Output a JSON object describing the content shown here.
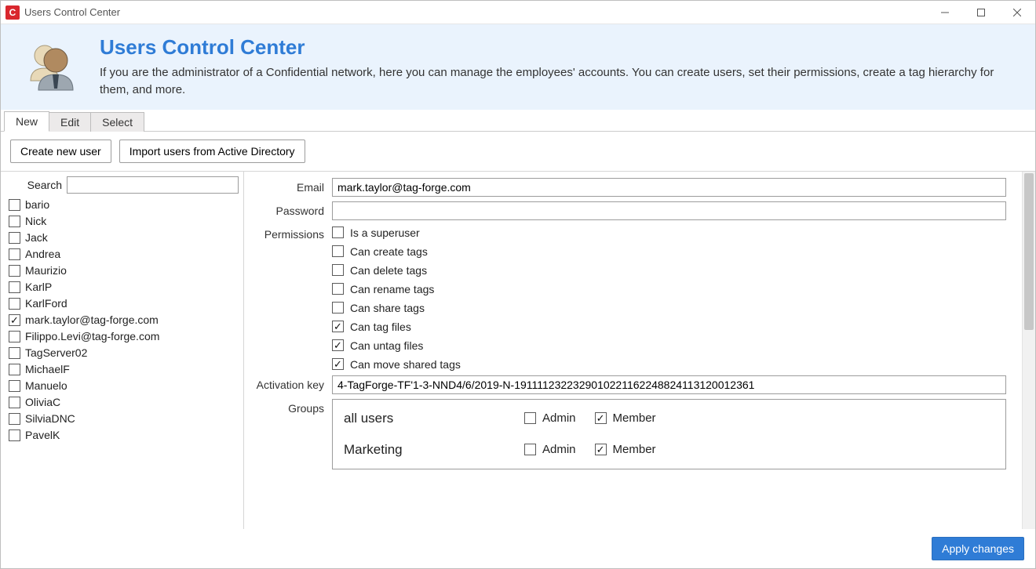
{
  "window": {
    "title": "Users Control Center"
  },
  "header": {
    "title": "Users Control Center",
    "description": "If you are the administrator of a Confidential network, here you can manage the employees' accounts. You can create users, set their permissions, create a tag hierarchy for them, and more."
  },
  "tabs": [
    {
      "label": "New",
      "active": true
    },
    {
      "label": "Edit",
      "active": false
    },
    {
      "label": "Select",
      "active": false
    }
  ],
  "actions": {
    "create_new_user": "Create new user",
    "import_ad": "Import users from Active Directory"
  },
  "sidebar": {
    "search_label": "Search",
    "search_value": "",
    "users": [
      {
        "name": "bario",
        "checked": false
      },
      {
        "name": "Nick",
        "checked": false
      },
      {
        "name": "Jack",
        "checked": false
      },
      {
        "name": "Andrea",
        "checked": false
      },
      {
        "name": "Maurizio",
        "checked": false
      },
      {
        "name": "KarlP",
        "checked": false
      },
      {
        "name": "KarlFord",
        "checked": false
      },
      {
        "name": "mark.taylor@tag-forge.com",
        "checked": true
      },
      {
        "name": "Filippo.Levi@tag-forge.com",
        "checked": false
      },
      {
        "name": "TagServer02",
        "checked": false
      },
      {
        "name": "MichaelF",
        "checked": false
      },
      {
        "name": "Manuelo",
        "checked": false
      },
      {
        "name": "OliviaC",
        "checked": false
      },
      {
        "name": "SilviaDNC",
        "checked": false
      },
      {
        "name": "PavelK",
        "checked": false
      }
    ]
  },
  "form": {
    "email_label": "Email",
    "email_value": "mark.taylor@tag-forge.com",
    "password_label": "Password",
    "password_value": "",
    "permissions_label": "Permissions",
    "permissions": [
      {
        "label": "Is a superuser",
        "checked": false
      },
      {
        "label": "Can create tags",
        "checked": false
      },
      {
        "label": "Can delete tags",
        "checked": false
      },
      {
        "label": "Can rename tags",
        "checked": false
      },
      {
        "label": "Can share tags",
        "checked": false
      },
      {
        "label": "Can tag files",
        "checked": true
      },
      {
        "label": "Can untag files",
        "checked": true
      },
      {
        "label": "Can move shared tags",
        "checked": true
      }
    ],
    "activation_label": "Activation key",
    "activation_value": "4-TagForge-TF'1-3-NND4/6/2019-N-19111123223290102211622488241131200123​61",
    "groups_label": "Groups",
    "groups_cols": {
      "admin": "Admin",
      "member": "Member"
    },
    "groups": [
      {
        "name": "all users",
        "admin": false,
        "member": true
      },
      {
        "name": "Marketing",
        "admin": false,
        "member": true
      }
    ]
  },
  "footer": {
    "apply": "Apply changes"
  }
}
